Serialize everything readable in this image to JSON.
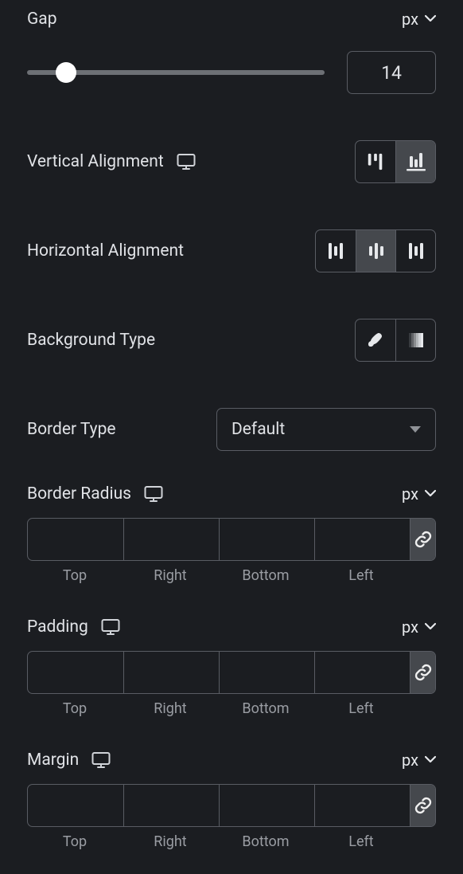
{
  "gap": {
    "label": "Gap",
    "unit": "px",
    "value": "14",
    "slider_pos_pct": 13
  },
  "valign": {
    "label": "Vertical Alignment",
    "active_index": 1
  },
  "halign": {
    "label": "Horizontal Alignment",
    "active_index": 1
  },
  "bgtype": {
    "label": "Background Type",
    "active_index": -1
  },
  "border_type": {
    "label": "Border Type",
    "value": "Default"
  },
  "border_radius": {
    "label": "Border Radius",
    "unit": "px",
    "sides": [
      "Top",
      "Right",
      "Bottom",
      "Left"
    ]
  },
  "padding": {
    "label": "Padding",
    "unit": "px",
    "sides": [
      "Top",
      "Right",
      "Bottom",
      "Left"
    ]
  },
  "margin": {
    "label": "Margin",
    "unit": "px",
    "sides": [
      "Top",
      "Right",
      "Bottom",
      "Left"
    ]
  }
}
